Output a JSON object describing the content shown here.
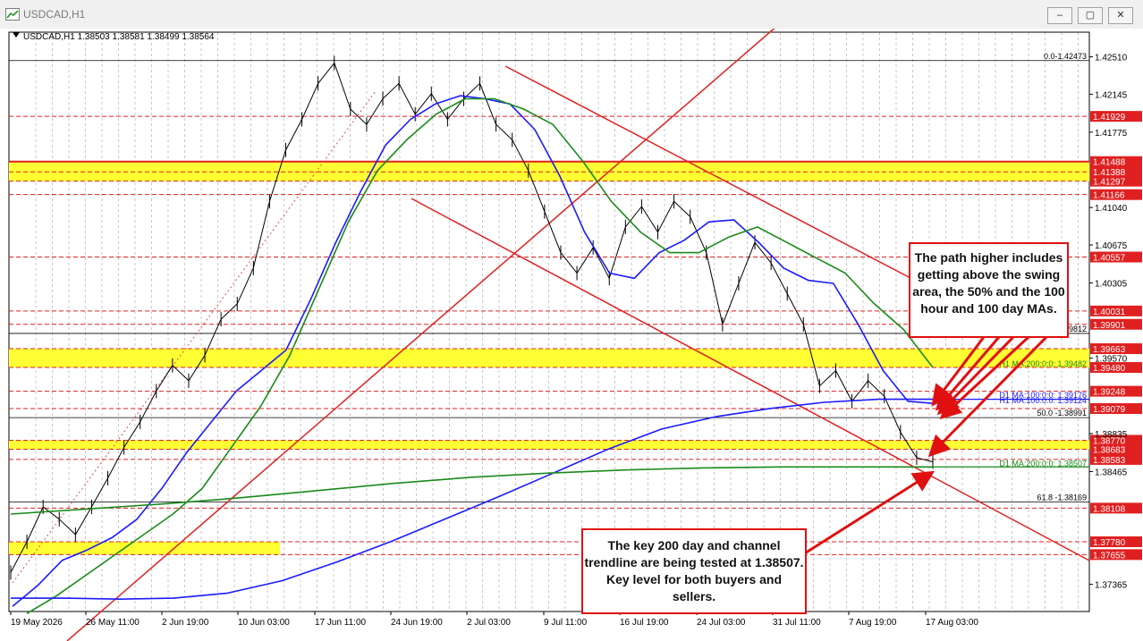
{
  "window": {
    "title": "USDCAD,H1",
    "icon": "chart-window-icon",
    "buttons": [
      {
        "name": "minimize-button",
        "icon": "minimize-icon",
        "glyph": "–"
      },
      {
        "name": "restore-button",
        "icon": "restore-icon",
        "glyph": "▢"
      },
      {
        "name": "close-button",
        "icon": "close-icon",
        "glyph": "✕"
      }
    ]
  },
  "chart_data": {
    "type": "line",
    "symbol_header": "USDCAD,H1  1.38503 1.38581 1.38499 1.38564",
    "yrange": [
      1.371,
      1.4275
    ],
    "x_tick_labels": [
      "19 May 2026",
      "26 May 11:00",
      "2 Jun 19:00",
      "10 Jun 03:00",
      "17 Jun 11:00",
      "24 Jun 19:00",
      "2 Jul 03:00",
      "9 Jul 11:00",
      "16 Jul 19:00",
      "24 Jul 03:00",
      "31 Jul 11:00",
      "7 Aug 19:00",
      "17 Aug 03:00"
    ],
    "y_tick_labels": [
      "1.42510",
      "1.42145",
      "1.41775",
      "1.41040",
      "1.40675",
      "1.40305",
      "1.39570",
      "1.38835",
      "1.38465",
      "1.37365"
    ],
    "price_levels": [
      {
        "label": "1.41929",
        "value": 1.41929
      },
      {
        "label": "1.41488",
        "value": 1.41488
      },
      {
        "label": "1.41388",
        "value": 1.41388
      },
      {
        "label": "1.41297",
        "value": 1.41297
      },
      {
        "label": "1.41166",
        "value": 1.41166
      },
      {
        "label": "1.40557",
        "value": 1.40557
      },
      {
        "label": "1.40031",
        "value": 1.40031
      },
      {
        "label": "1.39901",
        "value": 1.39901
      },
      {
        "label": "1.39663",
        "value": 1.39663
      },
      {
        "label": "1.39480",
        "value": 1.3948
      },
      {
        "label": "1.39248",
        "value": 1.39248
      },
      {
        "label": "1.39079",
        "value": 1.39079
      },
      {
        "label": "1.38770",
        "value": 1.3877
      },
      {
        "label": "1.38683",
        "value": 1.38683
      },
      {
        "label": "1.38583",
        "value": 1.38583
      },
      {
        "label": "1.38108",
        "value": 1.38108
      },
      {
        "label": "1.37780",
        "value": 1.3778
      },
      {
        "label": "1.37655",
        "value": 1.37655
      }
    ],
    "yellow_zones": [
      {
        "from": 1.41297,
        "to": 1.41488
      },
      {
        "from": 1.3948,
        "to": 1.39663
      },
      {
        "from": 1.38683,
        "to": 1.3877
      },
      {
        "from": 1.37655,
        "to": 1.3778
      }
    ],
    "fib_levels": [
      {
        "label": "0.0-1.42473",
        "value": 1.42473
      },
      {
        "label": "50.0 -1.39812",
        "value": 1.39812
      },
      {
        "label": "50.0 -1.38991",
        "value": 1.38991
      },
      {
        "label": "61.8 -1.38169",
        "value": 1.38169
      }
    ],
    "ma_labels": [
      {
        "label": "H1 MA:200:0:0: 1.39482",
        "value": 1.39482
      },
      {
        "label": "D1 MA:100:0:0: 1.39176",
        "value": 1.39176
      },
      {
        "label": "H1 MA:100:0:0: 1.39124",
        "value": 1.39124
      },
      {
        "label": "D1 MA:200:0:0: 1.38507",
        "value": 1.38507
      }
    ],
    "series": [
      {
        "role": "price",
        "color": "#000000",
        "values": [
          1.3748,
          1.3778,
          1.3812,
          1.38,
          1.3785,
          1.3812,
          1.384,
          1.387,
          1.3895,
          1.3925,
          1.395,
          1.3935,
          1.396,
          1.3995,
          1.401,
          1.4045,
          1.411,
          1.416,
          1.419,
          1.4225,
          1.4245,
          1.42,
          1.4185,
          1.421,
          1.4225,
          1.4195,
          1.4215,
          1.419,
          1.421,
          1.4225,
          1.4185,
          1.417,
          1.414,
          1.41,
          1.406,
          1.404,
          1.4065,
          1.4035,
          1.4085,
          1.4105,
          1.408,
          1.411,
          1.4095,
          1.406,
          1.399,
          1.403,
          1.407,
          1.405,
          1.402,
          1.399,
          1.393,
          1.3945,
          1.3915,
          1.3935,
          1.392,
          1.3885,
          1.386,
          1.3856
        ]
      },
      {
        "name": "H1 MA:100:0:0",
        "color": "#1a1aff",
        "values": [
          1.3715,
          1.3735,
          1.376,
          1.377,
          1.3782,
          1.38,
          1.383,
          1.3865,
          1.3895,
          1.3925,
          1.3945,
          1.3965,
          1.4015,
          1.407,
          1.412,
          1.4165,
          1.419,
          1.4205,
          1.4213,
          1.421,
          1.4205,
          1.418,
          1.4135,
          1.408,
          1.404,
          1.4035,
          1.406,
          1.4072,
          1.409,
          1.4092,
          1.407,
          1.4045,
          1.4033,
          1.403,
          1.399,
          1.3945,
          1.3915,
          1.3913
        ]
      },
      {
        "name": "H1 MA:200:0:0",
        "color": "#1a8a1a",
        "values": [
          1.3708,
          1.3725,
          1.3745,
          1.3765,
          1.3785,
          1.3805,
          1.383,
          1.387,
          1.391,
          1.396,
          1.4025,
          1.409,
          1.414,
          1.417,
          1.4195,
          1.421,
          1.421,
          1.42,
          1.4185,
          1.415,
          1.411,
          1.408,
          1.406,
          1.406,
          1.4075,
          1.4085,
          1.407,
          1.4055,
          1.404,
          1.401,
          1.3985,
          1.3948
        ]
      },
      {
        "name": "D1 MA:100:0:0",
        "color": "#1a1aff",
        "values": [
          1.3723,
          1.3723,
          1.3722,
          1.3723,
          1.3728,
          1.374,
          1.3758,
          1.3778,
          1.38,
          1.3822,
          1.3845,
          1.3868,
          1.3888,
          1.39,
          1.3908,
          1.3914,
          1.3917,
          1.3917
        ]
      },
      {
        "name": "D1 MA:200:0:0",
        "color": "#1a8a1a",
        "values": [
          1.3805,
          1.381,
          1.3815,
          1.3821,
          1.3828,
          1.3835,
          1.3841,
          1.3845,
          1.3848,
          1.385,
          1.3851,
          1.3851,
          1.3851
        ]
      }
    ]
  },
  "annotations": {
    "top_note": "The path higher includes getting above the swing area, the 50% and the 100 hour and 100  day MAs.",
    "bottom_note": "The key 200 day and channel trendline are being tested at 1.38507. Key level for both buyers and sellers."
  }
}
